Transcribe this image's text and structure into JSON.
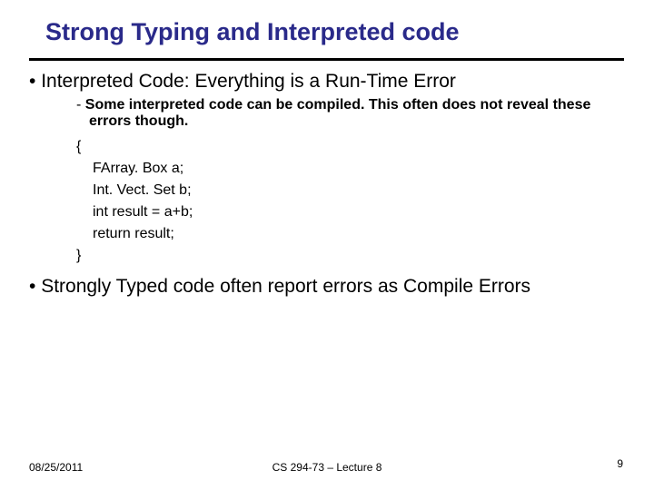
{
  "title": "Strong Typing and Interpreted code",
  "bullets": {
    "b1": "Interpreted Code: Everything is a Run-Time Error",
    "b1sub": "Some interpreted code can be compiled.  This often does not reveal these errors though.",
    "b2": "Strongly Typed code often report errors as Compile Errors"
  },
  "code": {
    "open": "{",
    "l1": "FArray. Box a;",
    "l2": "Int. Vect. Set b;",
    "l3": "int result = a+b;",
    "l4": "return result;",
    "close": "}"
  },
  "footer": {
    "date": "08/25/2011",
    "course": "CS 294-73 – Lecture 8",
    "page": "9"
  }
}
